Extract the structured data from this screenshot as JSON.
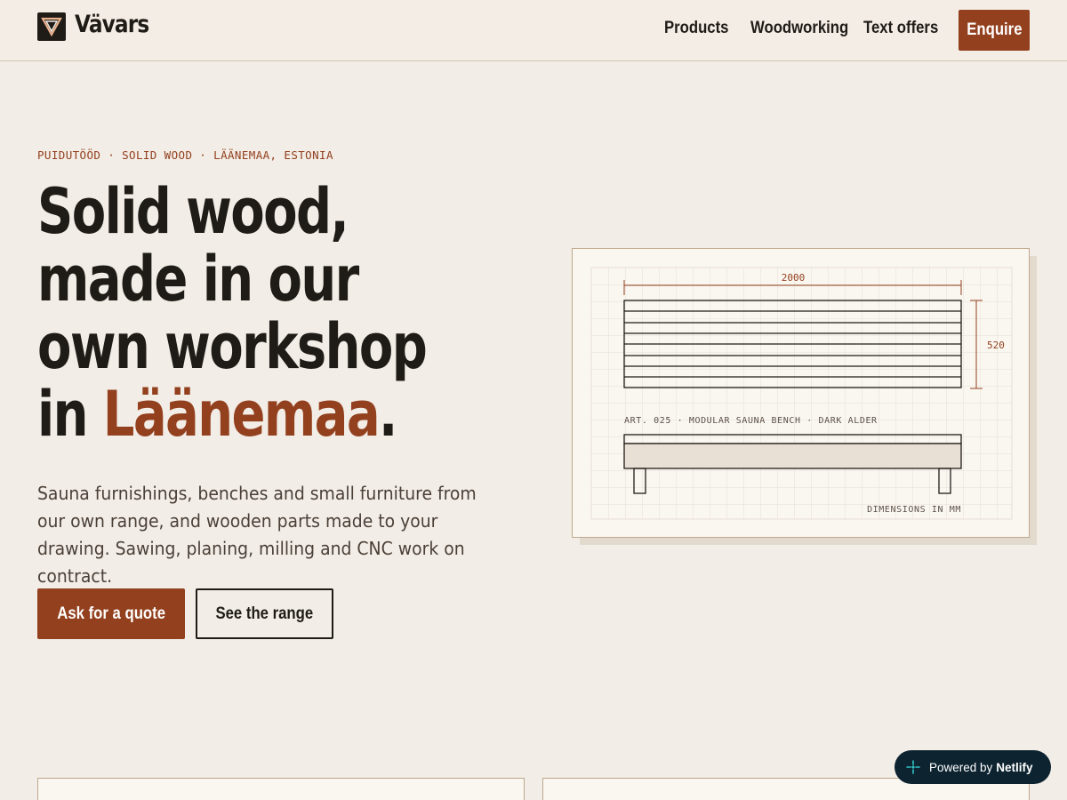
{
  "header": {
    "brand": "Vävars",
    "logo_icon": "triangle-logo-icon",
    "nav": [
      {
        "label": "Products"
      },
      {
        "label": "Woodworking"
      },
      {
        "label": "Text offers"
      }
    ],
    "enquire_label": "Enquire"
  },
  "hero": {
    "eyebrow": "PUIDUTÖÖD · SOLID WOOD · LÄÄNEMAA, ESTONIA",
    "headline_line1": "Solid wood,",
    "headline_line2": "made in our",
    "headline_line3": "own workshop",
    "headline_line4_prefix": "in ",
    "headline_accent": "Läänemaa",
    "headline_suffix": ".",
    "lede": "Sauna furnishings, benches and small furniture from our own range, and wooden parts made to your drawing. Sawing, planing, milling and CNC work on contract.",
    "primary_cta": "Ask for a quote",
    "secondary_cta": "See the range"
  },
  "drawing": {
    "width_dim": "2000",
    "height_dim": "520",
    "caption": "ART. 025 · MODULAR SAUNA BENCH · DARK ALDER",
    "units_note": "DIMENSIONS IN MM"
  },
  "badge": {
    "prefix": "Powered by",
    "brand": "Netlify",
    "icon": "netlify-icon"
  },
  "colors": {
    "accent": "#93401e",
    "background": "#f2ede6",
    "ink": "#1f1b17",
    "badge_bg": "#0d2330"
  }
}
